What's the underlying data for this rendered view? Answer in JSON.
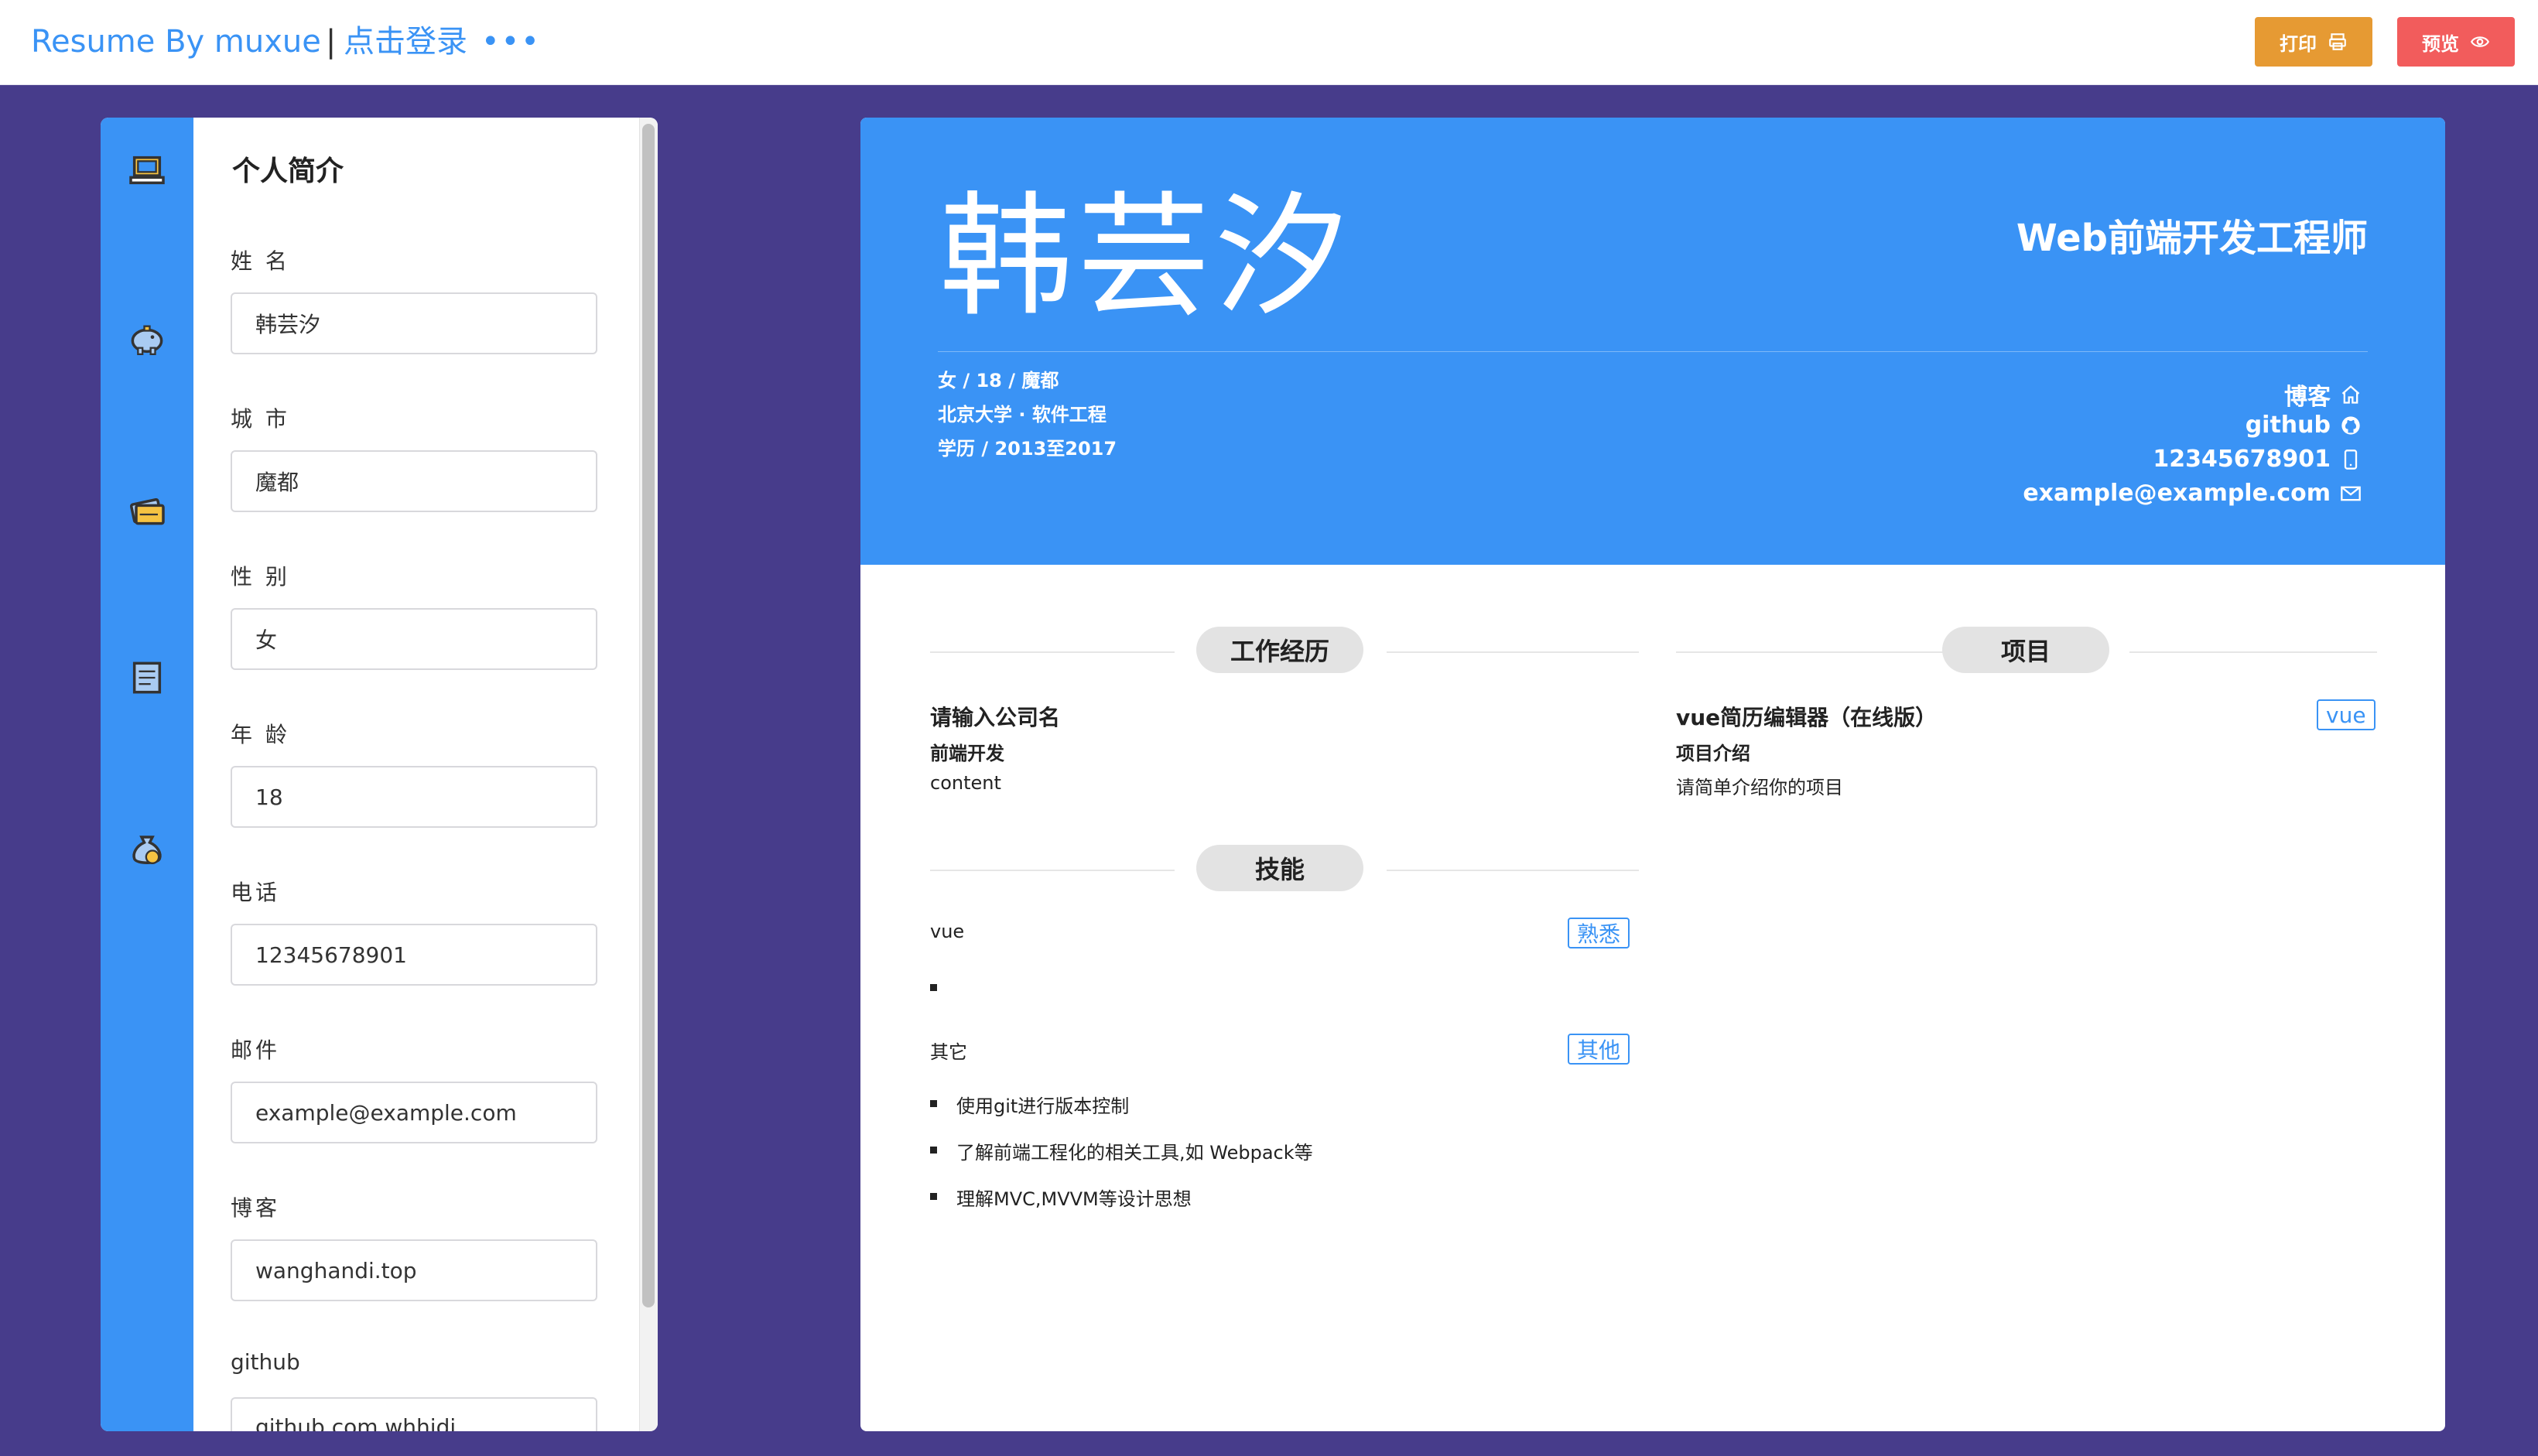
{
  "topbar": {
    "brand": "Resume By muxue",
    "brand_sep": "|",
    "login": "点击登录",
    "more": "•••",
    "print_label": "打印",
    "preview_label": "预览"
  },
  "rail": {
    "icons": [
      "laptop-icon",
      "piggy-bank-icon",
      "cards-icon",
      "document-icon",
      "money-bag-icon"
    ]
  },
  "editor": {
    "title": "个人简介",
    "fields": [
      {
        "label": "姓 名",
        "value": "韩芸汐"
      },
      {
        "label": "城 市",
        "value": "魔都"
      },
      {
        "label": "性 别",
        "value": "女"
      },
      {
        "label": "年 龄",
        "value": "18"
      },
      {
        "label": "电话",
        "value": "12345678901"
      },
      {
        "label": "邮件",
        "value": "example@example.com"
      },
      {
        "label": "博客",
        "value": "wanghandi.top"
      },
      {
        "label": "github",
        "value": "github.com whhidi"
      }
    ]
  },
  "resume": {
    "name": "韩芸汐",
    "job_title": "Web前端开发工程师",
    "info": [
      "女 / 18 / 魔都",
      "北京大学 · 软件工程",
      "学历 / 2013至2017"
    ],
    "contacts": [
      {
        "text": "博客",
        "icon": "home-icon"
      },
      {
        "text": "github",
        "icon": "github-icon"
      },
      {
        "text": "12345678901",
        "icon": "phone-icon"
      },
      {
        "text": "example@example.com",
        "icon": "mail-icon"
      }
    ],
    "work": {
      "heading": "工作经历",
      "company": "请输入公司名",
      "position": "前端开发",
      "content": "content"
    },
    "project": {
      "heading": "项目",
      "name": "vue简历编辑器（在线版）",
      "tag": "vue",
      "intro_label": "项目介绍",
      "intro": "请简单介绍你的项目"
    },
    "skills": {
      "heading": "技能",
      "groups": [
        {
          "name": "vue",
          "level": "熟悉",
          "items": []
        },
        {
          "name": "其它",
          "level": "其他",
          "items": [
            "使用git进行版本控制",
            "了解前端工程化的相关工具,如 Webpack等",
            "理解MVC,MVVM等设计思想"
          ]
        }
      ]
    }
  },
  "colors": {
    "accent": "#3a93f5",
    "background": "#473c8b",
    "print_button": "#e69a33",
    "preview_button": "#f25c5c"
  }
}
